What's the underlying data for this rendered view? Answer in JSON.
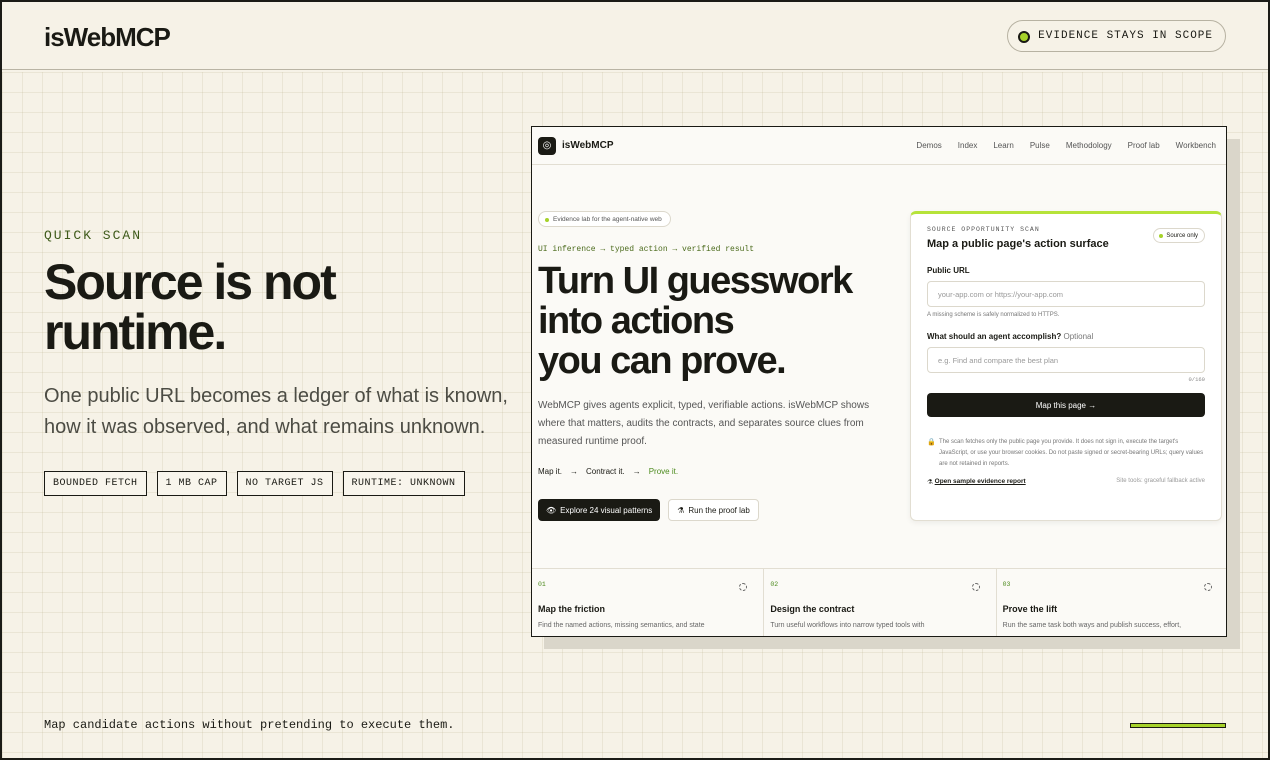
{
  "header": {
    "brand": "isWebMCP",
    "pill": "EVIDENCE STAYS IN SCOPE"
  },
  "hero": {
    "kicker": "QUICK SCAN",
    "title_line1": "Source is not",
    "title_line2": "runtime.",
    "lede": "One public URL becomes a ledger of what is known, how it was observed, and what remains unknown.",
    "tags": [
      "BOUNDED FETCH",
      "1 MB CAP",
      "NO TARGET JS",
      "RUNTIME: UNKNOWN"
    ]
  },
  "footer": {
    "text": "Map candidate actions without pretending to execute them."
  },
  "screenshot": {
    "brand": "isWebMCP",
    "nav": [
      "Demos",
      "Index",
      "Learn",
      "Pulse",
      "Methodology",
      "Proof lab",
      "Workbench"
    ],
    "badge": "Evidence lab for the agent-native web",
    "flow": "UI inference → typed action → verified result",
    "headline_line1": "Turn UI guesswork",
    "headline_line2": "into actions",
    "headline_line3": "you can prove.",
    "body": "WebMCP gives agents explicit, typed, verifiable actions. isWebMCP shows where that matters, audits the contracts, and separates source clues from measured runtime proof.",
    "steps": [
      "Map it.",
      "→",
      "Contract it.",
      "→",
      "Prove it."
    ],
    "primary_button": "Explore 24 visual patterns",
    "secondary_button": "Run the proof lab",
    "card": {
      "kicker": "SOURCE OPPORTUNITY SCAN",
      "title": "Map a public page's action surface",
      "source_pill": "Source only",
      "url_label": "Public URL",
      "url_placeholder": "your-app.com or https://your-app.com",
      "url_hint": "A missing scheme is safely normalized to HTTPS.",
      "goal_label": "What should an agent accomplish?",
      "goal_optional": "Optional",
      "goal_placeholder": "e.g. Find and compare the best plan",
      "goal_count": "0/160",
      "submit": "Map this page →",
      "note": "The scan fetches only the public page you provide. It does not sign in, execute the target's JavaScript, or use your browser cookies. Do not paste signed or secret-bearing URLs; query values are not retained in reports.",
      "sample_link": "Open sample evidence report",
      "mode": "Site tools: graceful fallback active"
    },
    "columns": [
      {
        "num": "01",
        "title": "Map the friction",
        "text": "Find the named actions, missing semantics, and state"
      },
      {
        "num": "02",
        "title": "Design the contract",
        "text": "Turn useful workflows into narrow typed tools with"
      },
      {
        "num": "03",
        "title": "Prove the lift",
        "text": "Run the same task both ways and publish success, effort,"
      }
    ]
  }
}
